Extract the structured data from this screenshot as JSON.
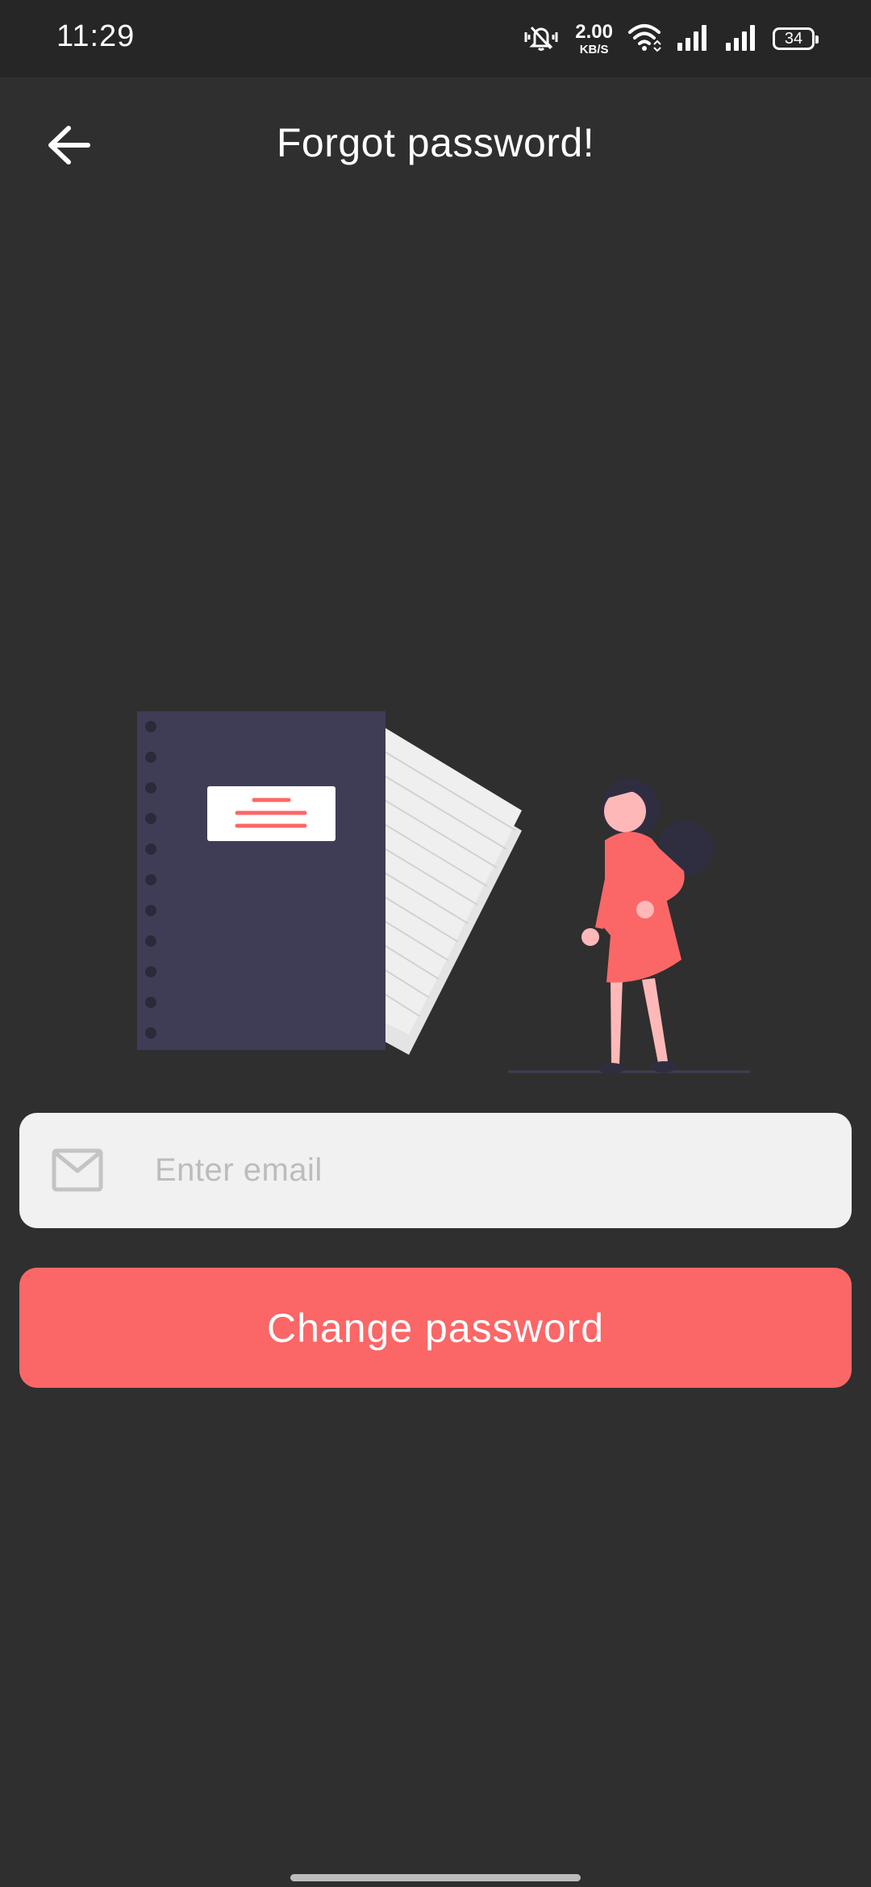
{
  "status_bar": {
    "time": "11:29",
    "net_speed_value": "2.00",
    "net_speed_unit": "KB/S",
    "battery_level": "34",
    "icons": [
      "vibrate-icon",
      "wifi-icon",
      "signal-icon",
      "signal-icon",
      "battery-icon"
    ]
  },
  "app_bar": {
    "title": "Forgot password!",
    "back_icon": "arrow-left-icon"
  },
  "form": {
    "email_placeholder": "Enter email",
    "email_value": "",
    "email_icon": "mail-icon",
    "submit_label": "Change password"
  },
  "colors": {
    "background": "#2f2f2f",
    "status_bar": "#262626",
    "accent": "#fb6767",
    "field_background": "#f1f1f1",
    "notebook": "#3f3d56"
  }
}
